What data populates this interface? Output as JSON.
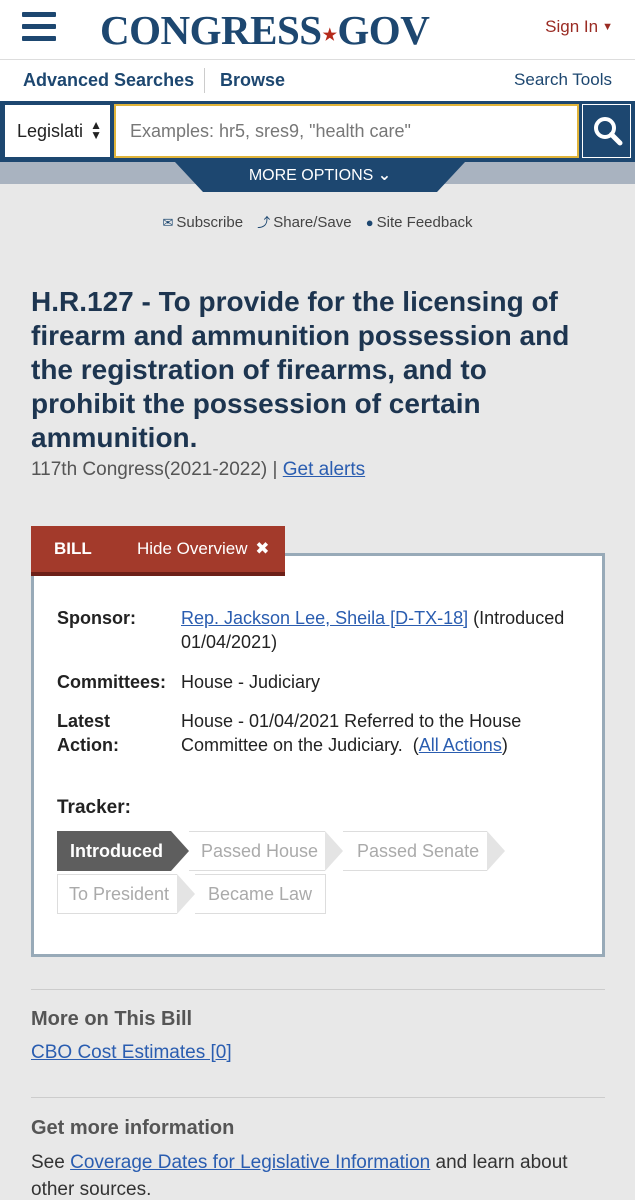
{
  "header": {
    "logo_left": "CONGRESS",
    "logo_star": "★",
    "logo_right": "GOV",
    "sign_in": "Sign In",
    "sign_in_caret": "▼"
  },
  "nav": {
    "advanced_searches": "Advanced Searches",
    "browse": "Browse",
    "search_tools": "Search Tools"
  },
  "search": {
    "select_value": "Legislati",
    "placeholder": "Examples: hr5, sres9, \"health care\"",
    "more_options": "MORE OPTIONS",
    "more_options_caret": "⌄"
  },
  "actions": {
    "subscribe": "Subscribe",
    "share_save": "Share/Save",
    "site_feedback": "Site Feedback"
  },
  "bill": {
    "title_lines": [
      "H.R.127 - To provide for the licensing of",
      "firearm and ammunition possession and",
      "the registration of firearms, and to",
      "prohibit the possession of certain",
      "ammunition."
    ],
    "congress": "117th Congress(2021-2022)",
    "separator": "|",
    "get_alerts": "Get alerts"
  },
  "overview": {
    "tab_label": "BILL",
    "hide_label": "Hide Overview",
    "hide_icon": "✖",
    "sponsor_label": "Sponsor:",
    "sponsor_link": "Rep. Jackson Lee, Sheila [D-TX-18]",
    "sponsor_intro_a": "(Introduced",
    "sponsor_intro_b": "01/04/2021)",
    "committees_label": "Committees:",
    "committees_value": "House - Judiciary",
    "latest_label_a": "Latest",
    "latest_label_b": "Action:",
    "latest_value_a": "House - 01/04/2021 Referred to the House",
    "latest_value_b": "Committee on the Judiciary.",
    "latest_paren_open": "(",
    "all_actions": "All Actions",
    "latest_paren_close": ")",
    "tracker_label": "Tracker:",
    "tracker_steps": [
      "Introduced",
      "Passed House",
      "Passed Senate",
      "To President",
      "Became Law"
    ],
    "tracker_active_index": 0
  },
  "more_on_bill": {
    "heading": "More on This Bill",
    "cbo_link": "CBO Cost Estimates [0]"
  },
  "more_info": {
    "heading": "Get more information",
    "text_see": "See",
    "coverage_link": "Coverage Dates for Legislative Information",
    "text_after": "and learn about",
    "text_line2": "other sources."
  },
  "colors": {
    "navy": "#1d4770",
    "tab_red": "#a33a2b",
    "link_blue": "#2a5db0",
    "search_border": "#e0b43a"
  }
}
